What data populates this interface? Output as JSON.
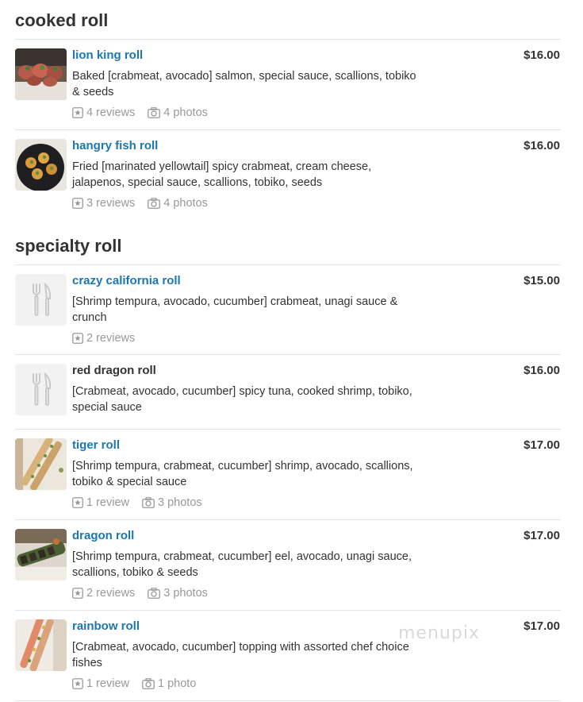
{
  "sections": [
    {
      "title": "cooked roll",
      "items": [
        {
          "name": "lion king roll",
          "price": "$16.00",
          "desc_lines": [
            "Baked [crabmeat, avocado] salmon, special sauce, scallions, tobiko",
            "& seeds"
          ],
          "reviews": "4 reviews",
          "photos": "4 photos",
          "thumb": "photo",
          "linked": true
        },
        {
          "name": "hangry fish roll",
          "price": "$16.00",
          "desc_lines": [
            "Fried [marinated yellowtail] spicy crabmeat, cream cheese,",
            "jalapenos, special sauce, scallions, tobiko, seeds"
          ],
          "reviews": "3 reviews",
          "photos": "4 photos",
          "thumb": "photo",
          "linked": true
        }
      ]
    },
    {
      "title": "specialty roll",
      "items": [
        {
          "name": "crazy california roll",
          "price": "$15.00",
          "desc_lines": [
            "[Shrimp tempura, avocado, cucumber] crabmeat, unagi sauce &",
            "crunch"
          ],
          "reviews": "2 reviews",
          "photos": "",
          "thumb": "placeholder",
          "linked": true
        },
        {
          "name": "red dragon roll",
          "price": "$16.00",
          "desc_lines": [
            "[Crabmeat, avocado, cucumber] spicy tuna, cooked shrimp, tobiko,",
            "special sauce"
          ],
          "reviews": "",
          "photos": "",
          "thumb": "placeholder",
          "linked": false
        },
        {
          "name": "tiger roll",
          "price": "$17.00",
          "desc_lines": [
            "[Shrimp tempura, crabmeat, cucumber] shrimp, avocado, scallions,",
            "tobiko & special sauce"
          ],
          "reviews": "1 review",
          "photos": "3 photos",
          "thumb": "photo",
          "linked": true
        },
        {
          "name": "dragon roll",
          "price": "$17.00",
          "desc_lines": [
            "[Shrimp tempura, crabmeat, cucumber] eel, avocado, unagi sauce,",
            "scallions, tobiko & seeds"
          ],
          "reviews": "2 reviews",
          "photos": "3 photos",
          "thumb": "photo",
          "linked": true
        },
        {
          "name": "rainbow roll",
          "price": "$17.00",
          "desc_lines": [
            "[Crabmeat, avocado, cucumber] topping with assorted chef choice",
            "fishes"
          ],
          "reviews": "1 review",
          "photos": "1 photo",
          "thumb": "photo",
          "linked": true
        }
      ]
    }
  ],
  "watermark": "menupix",
  "colors": {
    "link": "#1a77b3",
    "text": "#333333",
    "muted": "#999999",
    "rule": "#e3e3e3",
    "placeholder_bg": "#f2f2f2"
  },
  "icons": {
    "review": "star-badge-icon",
    "photos": "camera-icon",
    "placeholder": "fork-knife-icon"
  }
}
